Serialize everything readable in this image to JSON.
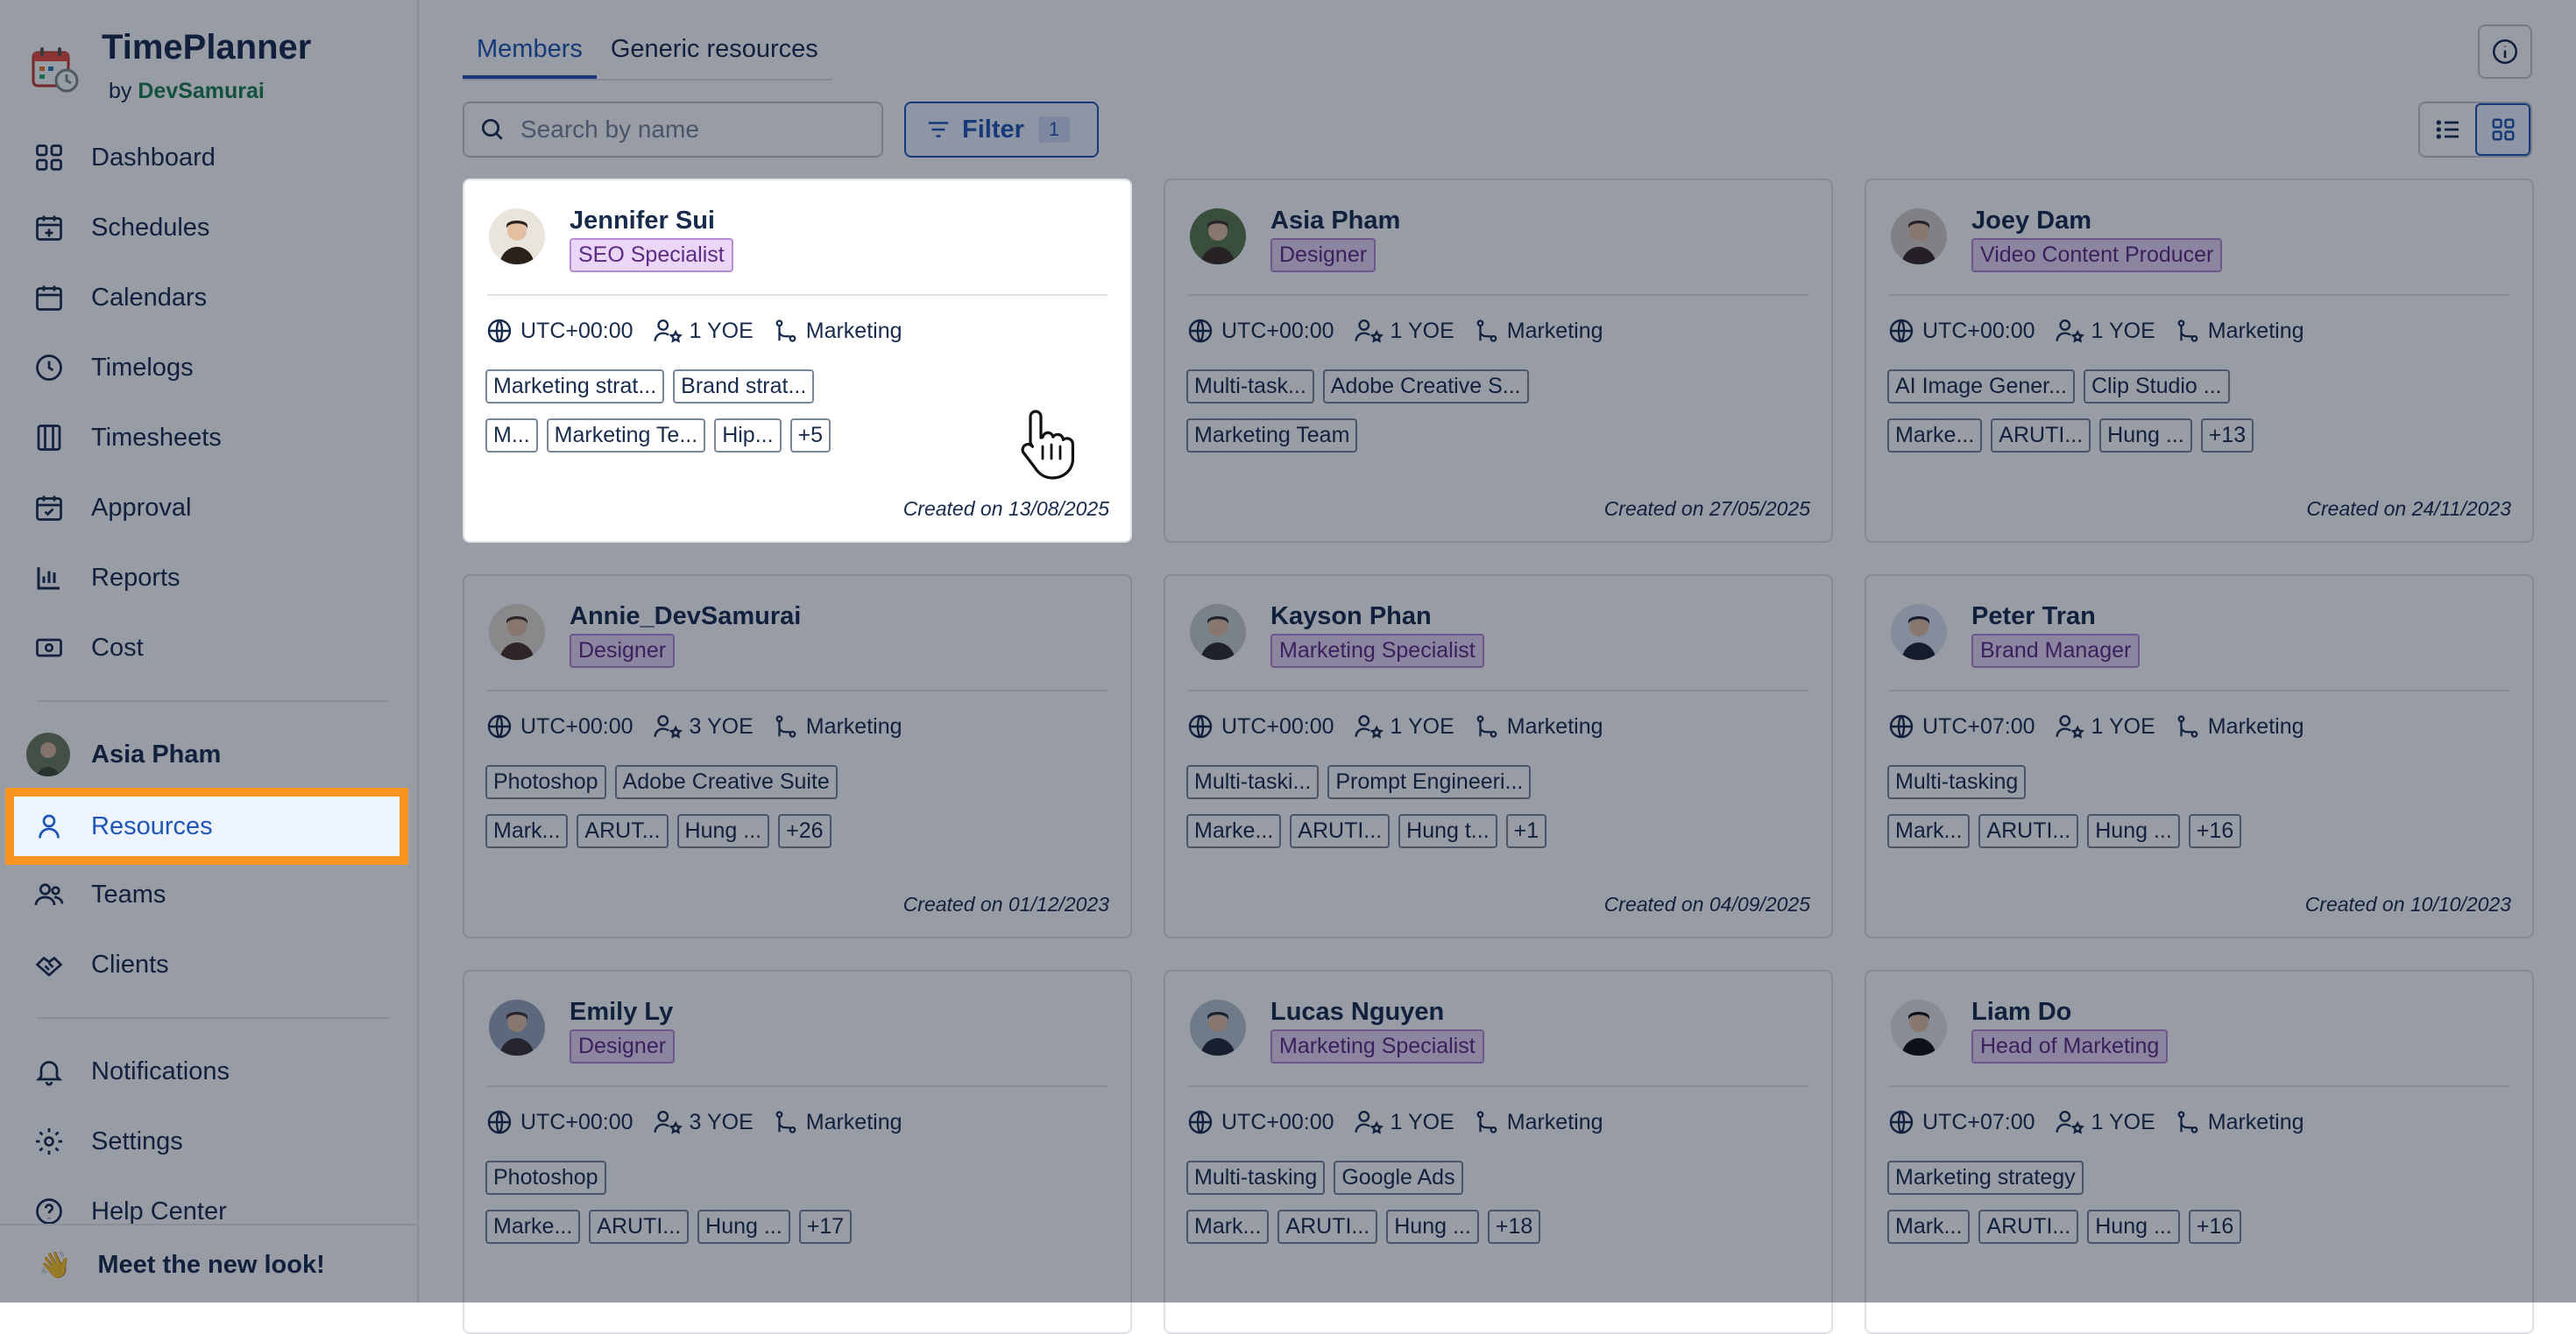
{
  "brand": {
    "title": "TimePlanner",
    "by_prefix": "by",
    "by_name": "DevSamurai"
  },
  "nav": {
    "items": [
      {
        "label": "Dashboard"
      },
      {
        "label": "Schedules"
      },
      {
        "label": "Calendars"
      },
      {
        "label": "Timelogs"
      },
      {
        "label": "Timesheets"
      },
      {
        "label": "Approval"
      },
      {
        "label": "Reports"
      },
      {
        "label": "Cost"
      }
    ],
    "profile_name": "Asia Pham",
    "resources": "Resources",
    "teams": "Teams",
    "clients": "Clients",
    "notifications": "Notifications",
    "settings": "Settings",
    "help": "Help Center",
    "footer_icon": "👋",
    "footer_text": "Meet the new look!"
  },
  "tabs": {
    "members": "Members",
    "generic": "Generic resources"
  },
  "search": {
    "placeholder": "Search by name",
    "value": ""
  },
  "filter": {
    "label": "Filter",
    "count": "1"
  },
  "view": {
    "active": "grid"
  },
  "colors": {
    "accent": "#1f55b5",
    "highlight": "#f7941d",
    "role_bg": "#ead7f7"
  },
  "cards": [
    {
      "name": "Jennifer Sui",
      "role": "SEO Specialist",
      "tz": "UTC+00:00",
      "yoe": "1 YOE",
      "dept": "Marketing",
      "tags1": [
        "Marketing strat...",
        "Brand strat..."
      ],
      "tags2": [
        "M...",
        "Marketing Te...",
        "Hip...",
        "+5"
      ],
      "created": "Created on 13/08/2025"
    },
    {
      "name": "Asia Pham",
      "role": "Designer",
      "tz": "UTC+00:00",
      "yoe": "1 YOE",
      "dept": "Marketing",
      "tags1": [
        "Multi-task...",
        "Adobe Creative S..."
      ],
      "tags2": [
        "Marketing Team"
      ],
      "created": "Created on 27/05/2025"
    },
    {
      "name": "Joey Dam",
      "role": "Video Content Producer",
      "tz": "UTC+00:00",
      "yoe": "1 YOE",
      "dept": "Marketing",
      "tags1": [
        "AI Image Gener...",
        "Clip Studio ..."
      ],
      "tags2": [
        "Marke...",
        "ARUTI...",
        "Hung ...",
        "+13"
      ],
      "created": "Created on 24/11/2023"
    },
    {
      "name": "Annie_DevSamurai",
      "role": "Designer",
      "tz": "UTC+00:00",
      "yoe": "3 YOE",
      "dept": "Marketing",
      "tags1": [
        "Photoshop",
        "Adobe Creative Suite"
      ],
      "tags2": [
        "Mark...",
        "ARUT...",
        "Hung ...",
        "+26"
      ],
      "created": "Created on 01/12/2023"
    },
    {
      "name": "Kayson Phan",
      "role": "Marketing Specialist",
      "tz": "UTC+00:00",
      "yoe": "1 YOE",
      "dept": "Marketing",
      "tags1": [
        "Multi-taski...",
        "Prompt Engineeri..."
      ],
      "tags2": [
        "Marke...",
        "ARUTI...",
        "Hung t...",
        "+1"
      ],
      "created": "Created on 04/09/2025"
    },
    {
      "name": "Peter Tran",
      "role": "Brand Manager",
      "tz": "UTC+07:00",
      "yoe": "1 YOE",
      "dept": "Marketing",
      "tags1": [
        "Multi-tasking"
      ],
      "tags2": [
        "Mark...",
        "ARUTI...",
        "Hung ...",
        "+16"
      ],
      "created": "Created on 10/10/2023"
    },
    {
      "name": "Emily Ly",
      "role": "Designer",
      "tz": "UTC+00:00",
      "yoe": "3 YOE",
      "dept": "Marketing",
      "tags1": [
        "Photoshop"
      ],
      "tags2": [
        "Marke...",
        "ARUTI...",
        "Hung ...",
        "+17"
      ],
      "created": ""
    },
    {
      "name": "Lucas Nguyen",
      "role": "Marketing Specialist",
      "tz": "UTC+00:00",
      "yoe": "1 YOE",
      "dept": "Marketing",
      "tags1": [
        "Multi-tasking",
        "Google Ads"
      ],
      "tags2": [
        "Mark...",
        "ARUTI...",
        "Hung ...",
        "+18"
      ],
      "created": ""
    },
    {
      "name": "Liam Do",
      "role": "Head of Marketing",
      "tz": "UTC+07:00",
      "yoe": "1 YOE",
      "dept": "Marketing",
      "tags1": [
        "Marketing strategy"
      ],
      "tags2": [
        "Mark...",
        "ARUTI...",
        "Hung ...",
        "+16"
      ],
      "created": ""
    }
  ]
}
